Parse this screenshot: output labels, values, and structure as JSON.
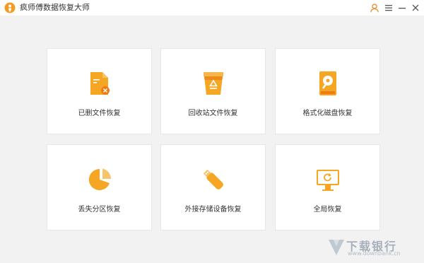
{
  "app": {
    "title": "疯师傅数据恢复大师"
  },
  "titlebar_buttons": [
    {
      "name": "user-icon"
    },
    {
      "name": "menu-icon"
    },
    {
      "name": "minimize-icon"
    },
    {
      "name": "close-icon"
    }
  ],
  "cards": [
    {
      "label": "已删文件恢复",
      "icon": "deleted-file-icon"
    },
    {
      "label": "回收站文件恢复",
      "icon": "recycle-bin-icon"
    },
    {
      "label": "格式化磁盘恢复",
      "icon": "formatted-disk-icon"
    },
    {
      "label": "丢失分区恢复",
      "icon": "lost-partition-icon"
    },
    {
      "label": "外接存储设备恢复",
      "icon": "usb-drive-icon"
    },
    {
      "label": "全局恢复",
      "icon": "monitor-restore-icon"
    }
  ],
  "watermark": {
    "text": "下载银行",
    "sub": "www.downbank.cn"
  },
  "colors": {
    "accent": "#f5a623",
    "accent_dark": "#ee7a12",
    "card_bg": "#ffffff",
    "window_bg": "#f2f2f2"
  }
}
